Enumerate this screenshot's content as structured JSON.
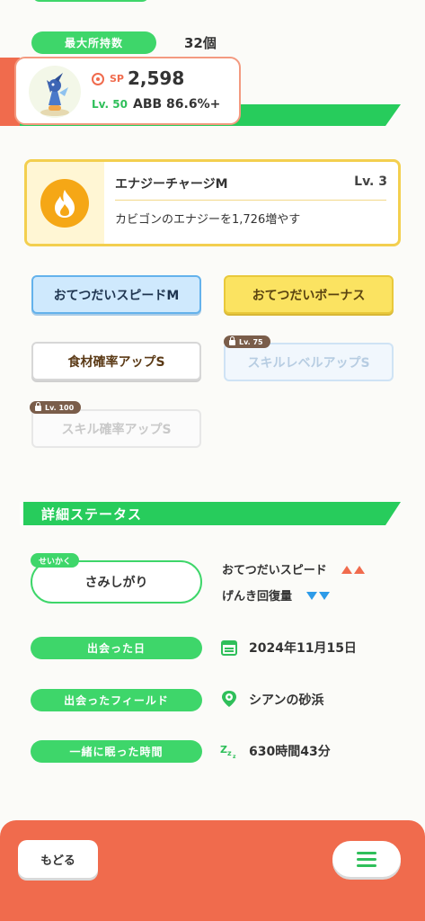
{
  "header": {
    "max_hold_label": "最大所持数",
    "max_hold_value": "32個"
  },
  "pokemon": {
    "sp_label": "SP",
    "sp_value": "2,598",
    "level": "Lv. 50",
    "abb": "ABB 86.6%+"
  },
  "main_skill": {
    "name": "エナジーチャージM",
    "level": "Lv. 3",
    "description": "カビゴンのエナジーを1,726増やす"
  },
  "sub_skills": [
    {
      "label": "おてつだいスピードM"
    },
    {
      "label": "おてつだいボーナス"
    },
    {
      "label": "食材確率アップS"
    },
    {
      "label": "スキルレベルアップS",
      "lock": "Lv. 75"
    },
    {
      "label": "スキル確率アップS",
      "lock": "Lv. 100"
    }
  ],
  "details": {
    "title": "詳細ステータス",
    "nature_tag": "せいかく",
    "nature": "さみしがり",
    "nature_up": "おてつだいスピード",
    "nature_down": "げんき回復量",
    "met_date_label": "出会った日",
    "met_date": "2024年11月15日",
    "met_field_label": "出会ったフィールド",
    "met_field": "シアンの砂浜",
    "sleep_label": "一緒に眠った時間",
    "sleep_time": "630時間43分"
  },
  "footer": {
    "back_label": "もどる"
  },
  "colors": {
    "green": "#3ed66a",
    "orange": "#f06b4d",
    "gold": "#f3cf4f",
    "blue": "#64b2ec"
  }
}
